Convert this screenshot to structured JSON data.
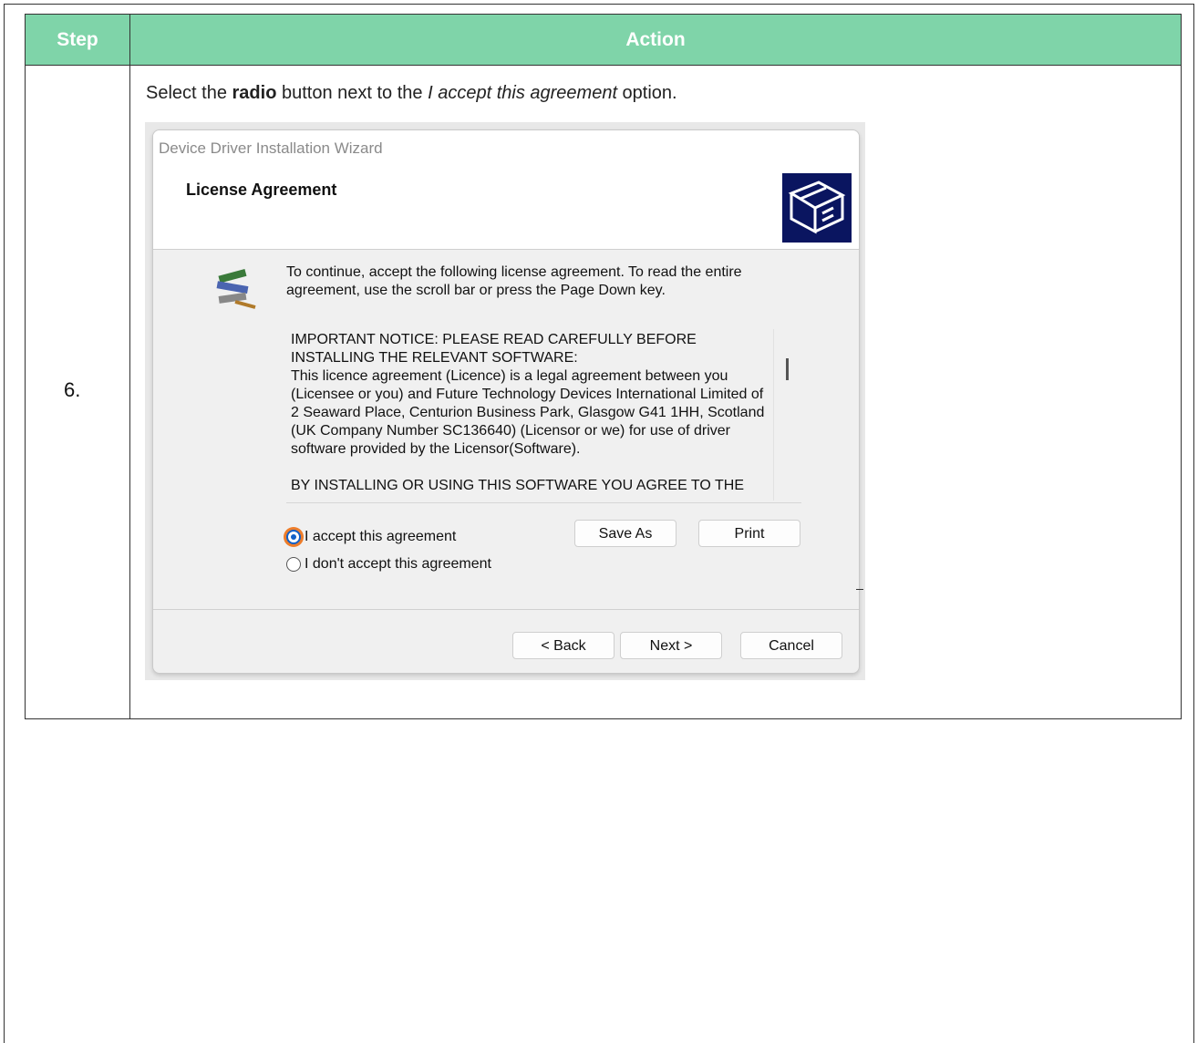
{
  "table": {
    "header_step": "Step",
    "header_action": "Action",
    "row": {
      "step_number": "6.",
      "instruction": {
        "part1": "Select the ",
        "bold": "radio",
        "part2": " button next to the ",
        "italic": "I accept this agreement",
        "part3": " option."
      }
    }
  },
  "colors": {
    "header_bg": "#7fd4a9",
    "wizard_logo_bg": "#0a1560",
    "highlight": "#ee7d2a"
  },
  "wizard": {
    "window_title": "Device Driver Installation Wizard",
    "heading": "License Agreement",
    "intro": "To continue, accept the following license agreement. To read the entire agreement, use the scroll bar or press the Page Down key.",
    "license_text": "IMPORTANT NOTICE: PLEASE READ CAREFULLY BEFORE\nINSTALLING THE RELEVANT SOFTWARE:\nThis licence agreement (Licence) is a legal agreement between you (Licensee or you) and Future Technology Devices International Limited of 2 Seaward Place, Centurion Business Park, Glasgow G41 1HH, Scotland (UK Company Number SC136640) (Licensor or we) for use of driver software provided by the Licensor(Software).\n\nBY INSTALLING OR USING THIS SOFTWARE YOU AGREE TO THE",
    "radio_accept": "I accept this agreement",
    "radio_decline": "I don't accept this agreement",
    "accept_selected": true,
    "save_as_label": "Save As",
    "print_label": "Print",
    "back_label": "< Back",
    "next_label": "Next >",
    "cancel_label": "Cancel",
    "logo_icon": "installer-box-icon",
    "intro_icon": "installer-tools-icon"
  }
}
